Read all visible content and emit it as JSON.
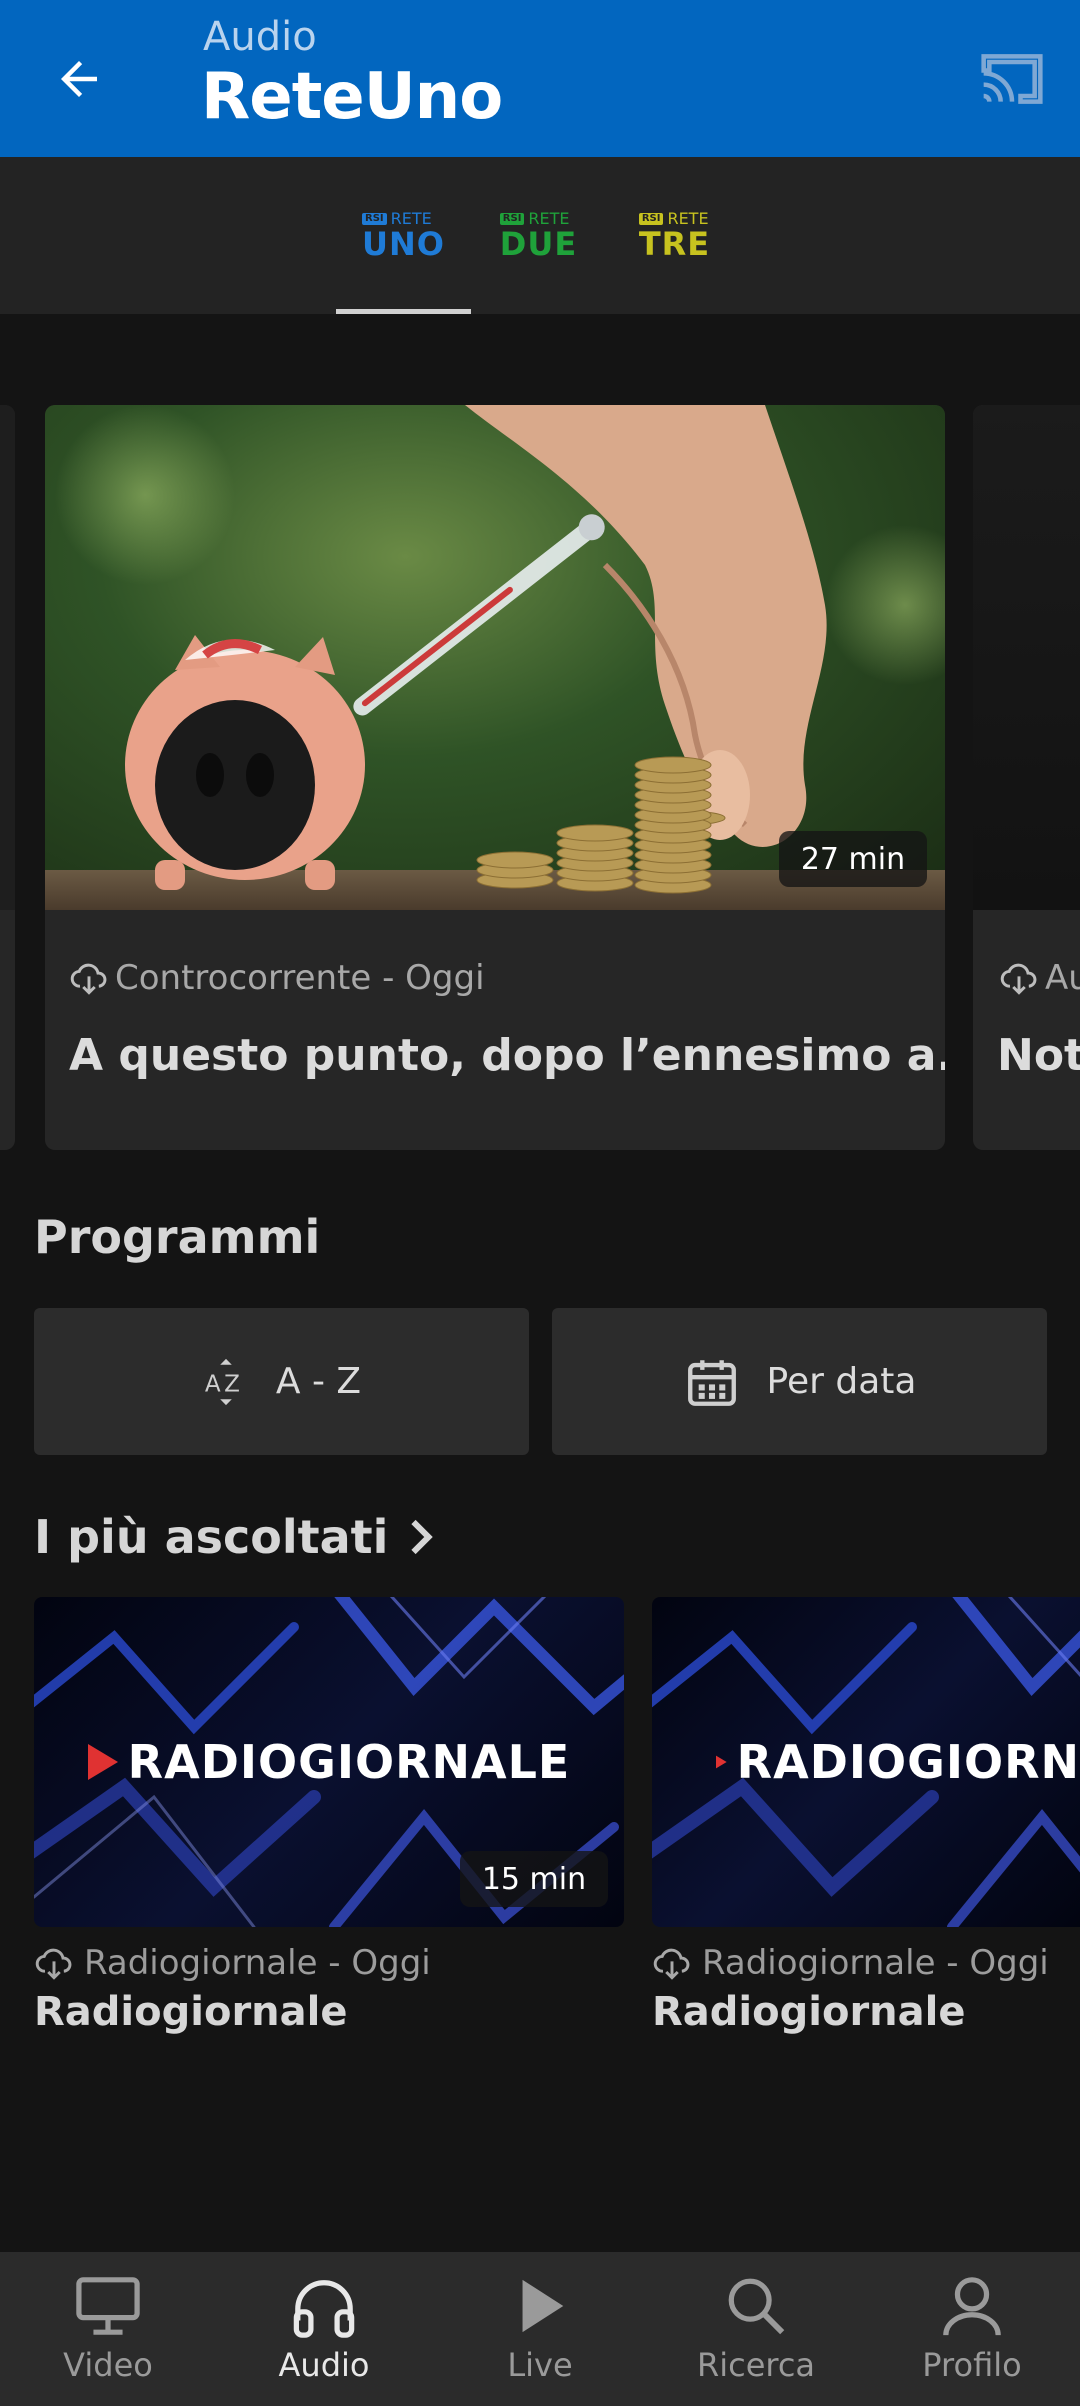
{
  "header": {
    "section": "Audio",
    "title": "ReteUno",
    "back_icon": "arrow-left-icon",
    "cast_icon": "cast-icon",
    "bg_color": "#0266bf"
  },
  "channels": {
    "selected": "ReteUno",
    "tabs": [
      {
        "rsi": "RSI",
        "rete": "RETE",
        "name": "UNO",
        "color": "#1f7bd6"
      },
      {
        "rsi": "RSI",
        "rete": "RETE",
        "name": "DUE",
        "color": "#1fa23a"
      },
      {
        "rsi": "RSI",
        "rete": "RETE",
        "name": "TRE",
        "color": "#c7c21f"
      }
    ]
  },
  "featured": {
    "items": [
      {
        "duration": "27 min",
        "meta": "Controcorrente - Oggi",
        "title": "A questo punto, dopo l’ennesimo a..."
      },
      {
        "meta": "Au",
        "title": "Not"
      }
    ]
  },
  "programmi": {
    "title": "Programmi",
    "az_label": "A - Z",
    "date_label": "Per data"
  },
  "most_listened": {
    "title": "I più ascoltati",
    "items": [
      {
        "image_title": "RADIOGIORNALE",
        "duration": "15 min",
        "meta": "Radiogiornale - Oggi",
        "title": "Radiogiornale"
      },
      {
        "image_title": "RADIOGIORN",
        "meta": "Radiogiornale - Oggi",
        "title": "Radiogiornale"
      }
    ]
  },
  "bottom_nav": {
    "active": "Audio",
    "items": [
      {
        "label": "Video",
        "icon": "monitor-icon"
      },
      {
        "label": "Audio",
        "icon": "headphones-icon"
      },
      {
        "label": "Live",
        "icon": "play-icon"
      },
      {
        "label": "Ricerca",
        "icon": "search-icon"
      },
      {
        "label": "Profilo",
        "icon": "user-icon"
      }
    ]
  }
}
